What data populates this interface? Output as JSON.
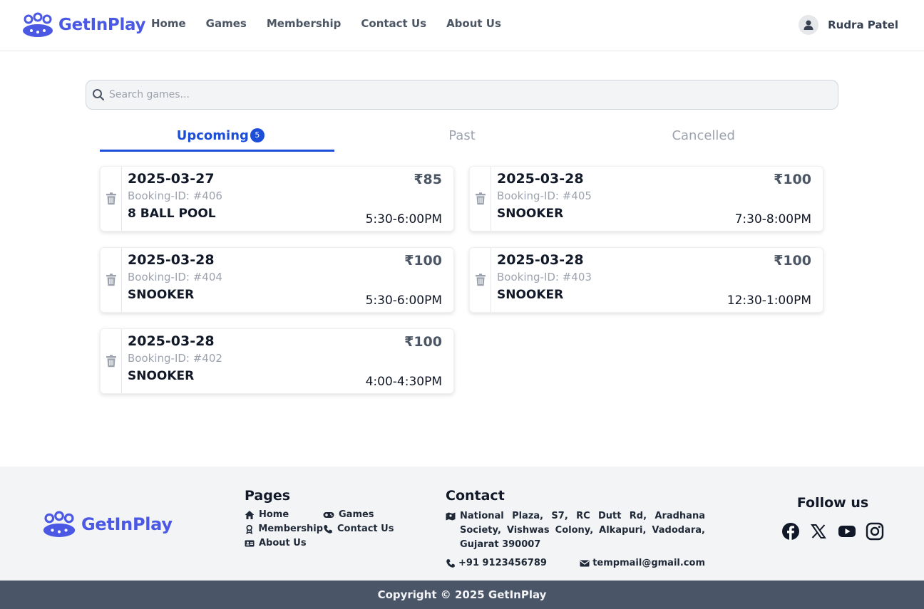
{
  "brand": {
    "name": "GetInPlay"
  },
  "nav": {
    "items": [
      "Home",
      "Games",
      "Membership",
      "Contact Us",
      "About Us"
    ]
  },
  "user": {
    "name": "Rudra Patel"
  },
  "search": {
    "placeholder": "Search games..."
  },
  "tabs": [
    {
      "label": "Upcoming",
      "badge": "5"
    },
    {
      "label": "Past"
    },
    {
      "label": "Cancelled"
    }
  ],
  "bookings": [
    {
      "date": "2025-03-27",
      "price": "₹85",
      "id": "Booking-ID: #406",
      "game": "8 BALL POOL",
      "time": "5:30-6:00PM"
    },
    {
      "date": "2025-03-28",
      "price": "₹100",
      "id": "Booking-ID: #405",
      "game": "SNOOKER",
      "time": "7:30-8:00PM"
    },
    {
      "date": "2025-03-28",
      "price": "₹100",
      "id": "Booking-ID: #404",
      "game": "SNOOKER",
      "time": "5:30-6:00PM"
    },
    {
      "date": "2025-03-28",
      "price": "₹100",
      "id": "Booking-ID: #403",
      "game": "SNOOKER",
      "time": "12:30-1:00PM"
    },
    {
      "date": "2025-03-28",
      "price": "₹100",
      "id": "Booking-ID: #402",
      "game": "SNOOKER",
      "time": "4:00-4:30PM"
    }
  ],
  "footer": {
    "pages_heading": "Pages",
    "pages": [
      "Home",
      "Games",
      "Membership",
      "Contact Us",
      "About Us"
    ],
    "contact_heading": "Contact",
    "address": "National Plaza, S7, RC Dutt Rd, Aradhana Society, Vishwas Colony, Alkapuri, Vadodara, Gujarat 390007",
    "phone": "+91 9123456789",
    "email": "tempmail@gmail.com",
    "follow_heading": "Follow us",
    "copyright": "Copyright © 2025 GetInPlay"
  },
  "colors": {
    "brand": "#4a58e3",
    "accent": "#1d4ed8",
    "footer_bar": "#4a5568"
  },
  "icons": [
    "trash-icon",
    "search-icon",
    "user-icon",
    "home-icon",
    "gamepad-icon",
    "award-icon",
    "phone-icon",
    "id-card-icon",
    "map-icon",
    "mail-icon",
    "facebook-icon",
    "x-icon",
    "youtube-icon",
    "instagram-icon"
  ]
}
